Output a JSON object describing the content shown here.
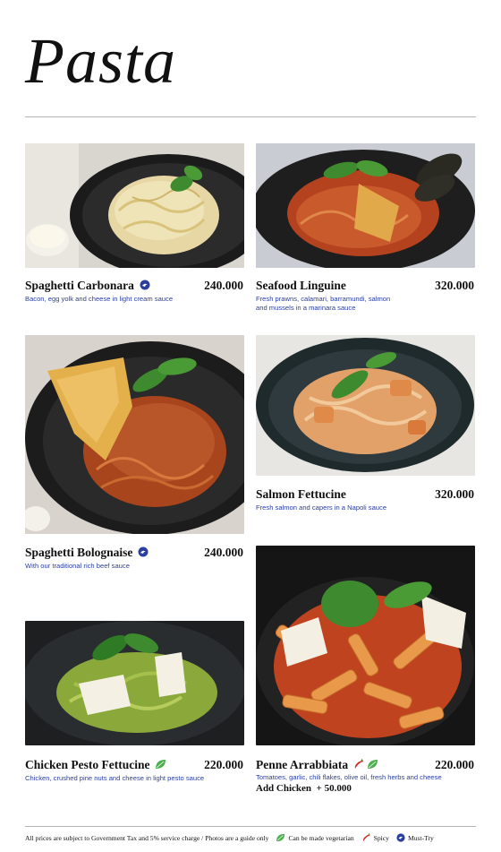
{
  "header": {
    "title": "Pasta"
  },
  "dishes": [
    {
      "name": "Spaghetti Carbonara",
      "price": "240.000",
      "description": "Bacon, egg yolk and cheese in light cream sauce",
      "tag_icon": "must-try-icon"
    },
    {
      "name": "Seafood Linguine",
      "price": "320.000",
      "description_lines": [
        "Fresh prawns, calamari, barramundi, salmon",
        "and mussels in a marinara sauce"
      ]
    },
    {
      "name": "Spaghetti Bolognaise",
      "price": "240.000",
      "description": "With our traditional rich beef sauce",
      "tag_icon": "must-try-icon"
    },
    {
      "name": "Salmon Fettucine",
      "price": "320.000",
      "description": "Fresh salmon and capers in a Napoli sauce"
    },
    {
      "name": "Chicken Pesto Fettucine",
      "price": "220.000",
      "description": "Chicken, crushed pine nuts and cheese in light pesto sauce",
      "tag_icon": "vegetarian-leaf-icon"
    },
    {
      "name": "Penne Arrabbiata",
      "price": "220.000",
      "description": "Tomatoes, garlic, chili flakes, olive oil, fresh herbs and cheese",
      "tag_icons": [
        "spicy-chili-icon",
        "vegetarian-leaf-icon"
      ],
      "extra": "Add Chicken  + 50.000"
    }
  ],
  "footer": {
    "note": "All prices are subject to Government Tax and 5% service charge / Photos are a guide only",
    "legend": [
      {
        "icon": "vegetarian-leaf-icon",
        "label": "Can be made vegetarian"
      },
      {
        "icon": "spicy-chili-icon",
        "label": "Spicy"
      },
      {
        "icon": "must-try-icon",
        "label": "Must-Try"
      }
    ]
  },
  "colors": {
    "accent_blue": "#2b3fa0",
    "leaf_green": "#4caf50",
    "chili_red": "#d32f2f"
  }
}
